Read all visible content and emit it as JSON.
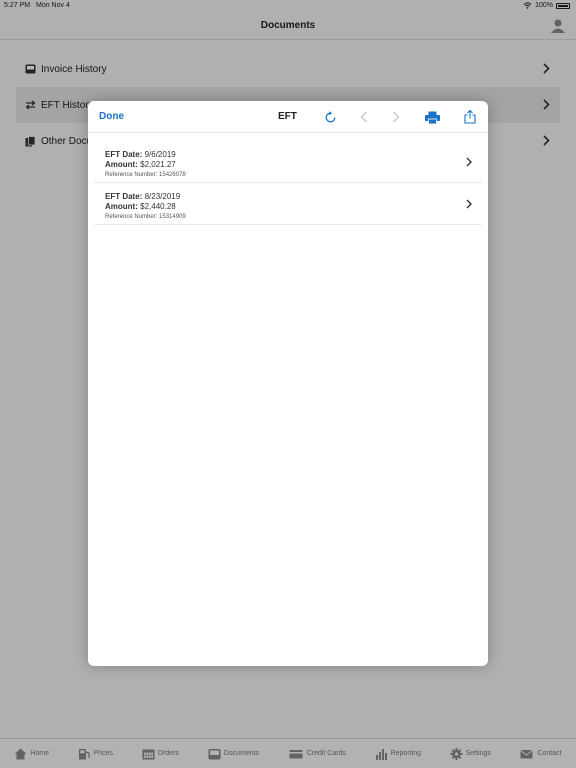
{
  "status_bar": {
    "time": "5:27 PM",
    "date": "Mon Nov 4",
    "battery": "100%"
  },
  "nav": {
    "title": "Documents"
  },
  "documents": [
    {
      "label": "Invoice History",
      "icon": "inbox-icon"
    },
    {
      "label": "EFT History",
      "icon": "transfer-icon"
    },
    {
      "label": "Other Documents",
      "icon": "documents-icon"
    }
  ],
  "modal": {
    "done_label": "Done",
    "title": "EFT",
    "accent_color": "#1a73c8",
    "rows": [
      {
        "date_label": "EFT Date:",
        "date": "9/6/2019",
        "amount_label": "Amount:",
        "amount": "$2,021.27",
        "ref_label": "Reference Number:",
        "ref": "15426078"
      },
      {
        "date_label": "EFT Date:",
        "date": "8/23/2019",
        "amount_label": "Amount:",
        "amount": "$2,440.28",
        "ref_label": "Reference Number:",
        "ref": "15314909"
      }
    ]
  },
  "tabs": [
    {
      "label": "Home",
      "icon": "home-icon"
    },
    {
      "label": "Prices",
      "icon": "fuel-icon"
    },
    {
      "label": "Orders",
      "icon": "calendar-icon"
    },
    {
      "label": "Documents",
      "icon": "inbox-icon"
    },
    {
      "label": "Credit Cards",
      "icon": "credit-card-icon"
    },
    {
      "label": "Reporting",
      "icon": "bar-chart-icon"
    },
    {
      "label": "Settings",
      "icon": "gear-icon"
    },
    {
      "label": "Contact",
      "icon": "mail-icon"
    }
  ]
}
